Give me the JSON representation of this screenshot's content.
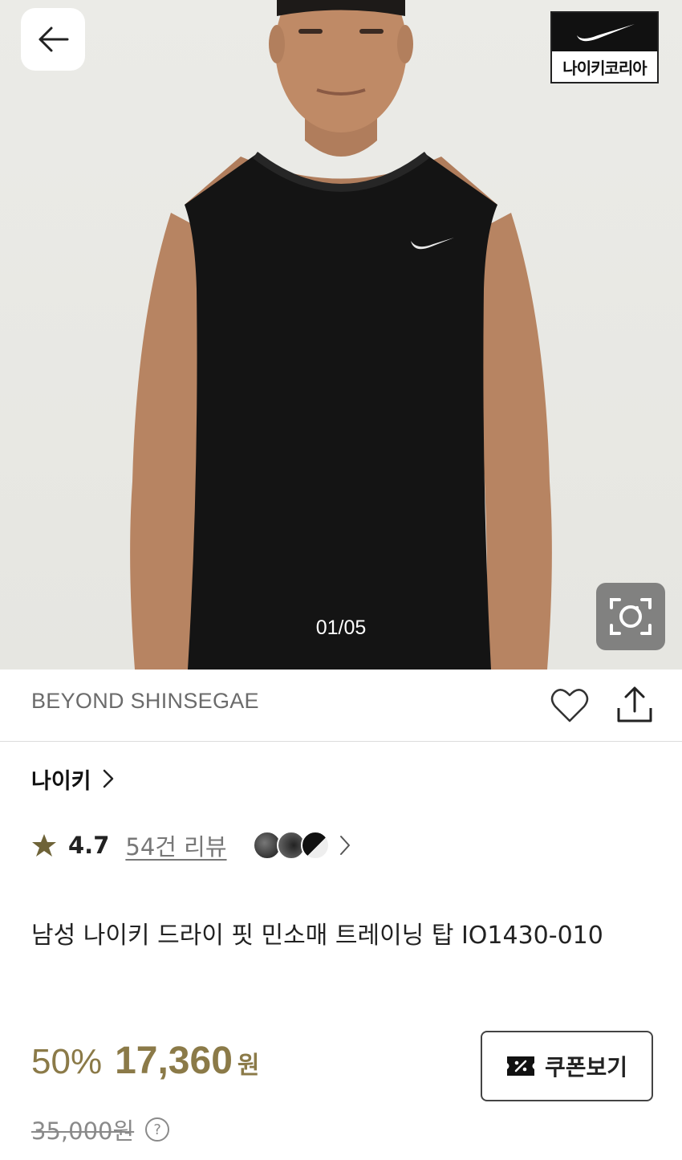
{
  "hero": {
    "image_counter": "01/05",
    "brand_logo_text": "나이키코리아"
  },
  "store": {
    "name": "BEYOND SHINSEGAE"
  },
  "brand": {
    "name": "나이키"
  },
  "rating": {
    "value": "4.7",
    "review_link": "54건 리뷰"
  },
  "product": {
    "title": "남성 나이키 드라이 핏 민소매 트레이닝 탑 IO1430-010"
  },
  "price": {
    "discount": "50%",
    "sale": "17,360",
    "currency": "원",
    "original": "35,000원"
  },
  "coupon": {
    "label": "쿠폰보기"
  },
  "colors": {
    "accent_gold": "#8b7a48",
    "muted_text": "#8a8a8a"
  }
}
